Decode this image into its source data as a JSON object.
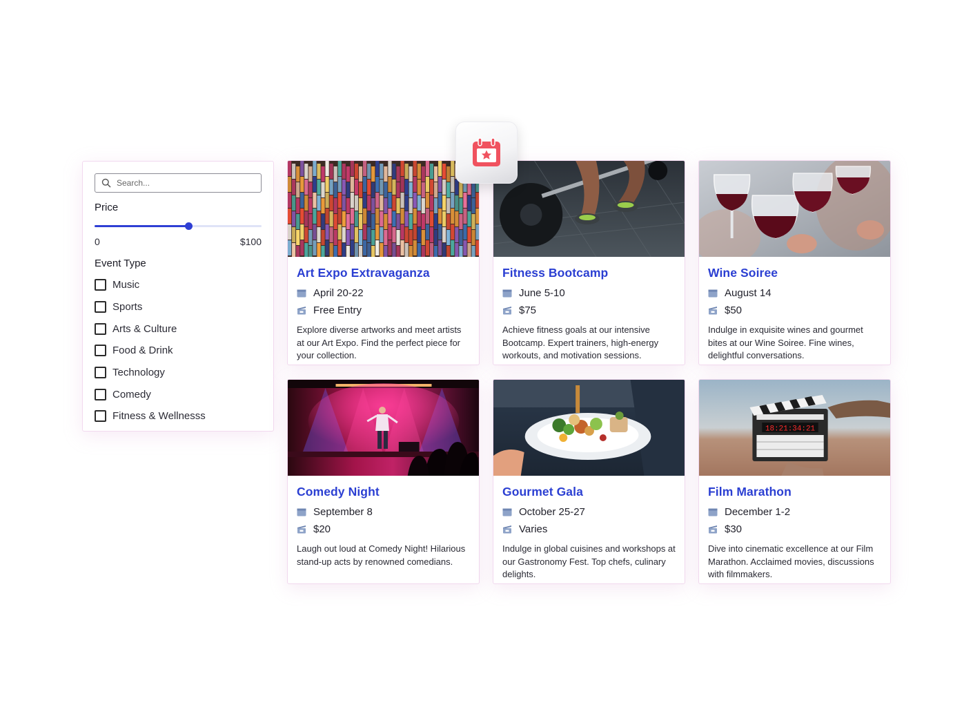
{
  "search": {
    "placeholder": "Search..."
  },
  "filters": {
    "price_label": "Price",
    "price_min": "0",
    "price_max": "$100",
    "price_slider_fraction": 0.56,
    "event_type_label": "Event Type",
    "event_types": [
      "Music",
      "Sports",
      "Arts & Culture",
      "Food & Drink",
      "Technology",
      "Comedy",
      "Fitness & Wellnesss"
    ]
  },
  "colors": {
    "accent": "#2b3fd2",
    "slider": "#2f3fd4",
    "calendar_icon": "#f0525f",
    "meta_icon": "#8ea3c8"
  },
  "icons": {
    "floating_tile": "calendar-star-icon",
    "date": "calendar-icon",
    "price": "ticket-icon",
    "search": "search-icon"
  },
  "events": [
    {
      "title": "Art Expo Extravaganza",
      "date": "April 20-22",
      "price": "Free Entry",
      "description": "Explore diverse artworks and meet artists at our Art Expo. Find the perfect piece for your collection.",
      "image": "art-installation-photo"
    },
    {
      "title": "Fitness Bootcamp",
      "date": "June 5-10",
      "price": "$75",
      "description": "Achieve fitness goals at our intensive Bootcamp. Expert trainers, high-energy workouts, and motivation sessions.",
      "image": "barbell-workout-photo"
    },
    {
      "title": "Wine Soiree",
      "date": "August 14",
      "price": "$50",
      "description": "Indulge in exquisite wines and gourmet bites at our Wine Soiree. Fine wines, delightful conversations.",
      "image": "wine-toast-photo"
    },
    {
      "title": "Comedy Night",
      "date": "September 8",
      "price": "$20",
      "description": "Laugh out loud at Comedy Night! Hilarious stand-up acts by renowned comedians.",
      "image": "stage-performer-photo"
    },
    {
      "title": "Gourmet Gala",
      "date": "October 25-27",
      "price": "Varies",
      "description": "Indulge in global cuisines and workshops at our Gastronomy Fest. Top chefs, culinary delights.",
      "image": "plated-dish-photo"
    },
    {
      "title": "Film Marathon",
      "date": "December 1-2",
      "price": "$30",
      "description": "Dive into cinematic excellence at our Film Marathon. Acclaimed movies, discussions with filmmakers.",
      "image": "film-clapperboard-photo"
    }
  ]
}
